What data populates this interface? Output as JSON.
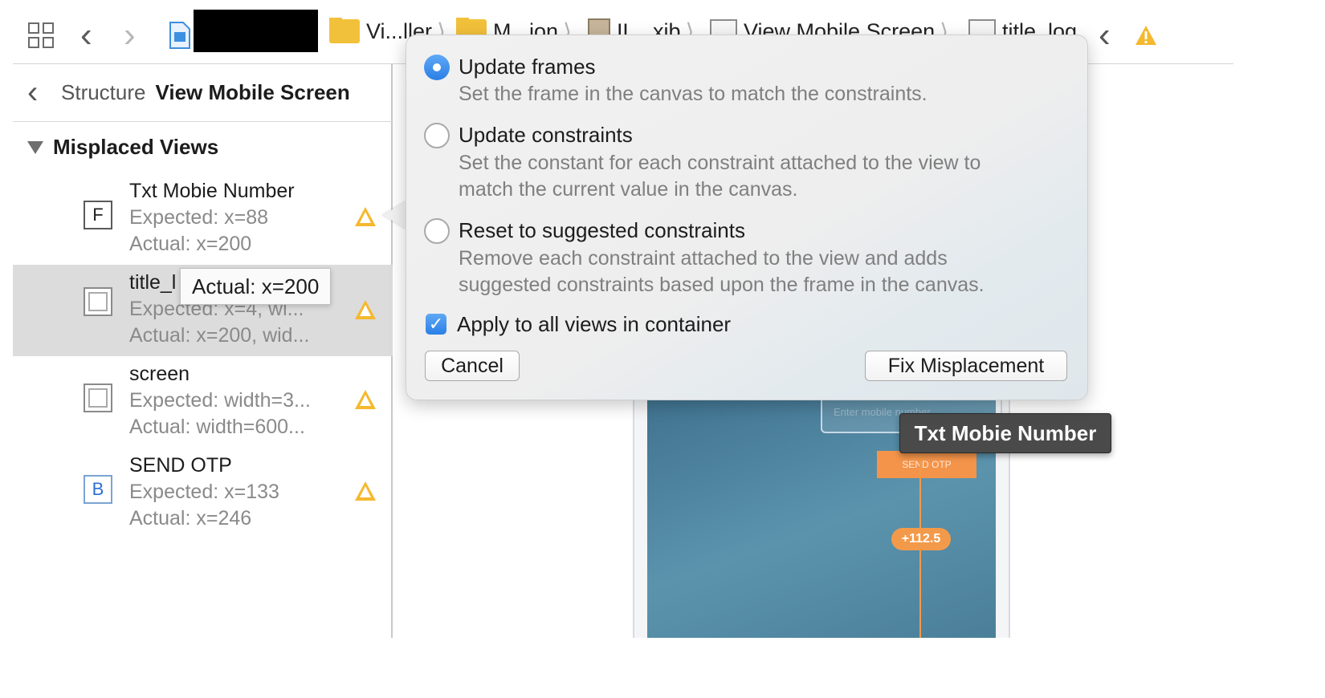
{
  "breadcrumbs": [
    {
      "label": "Vi...ller",
      "icon": "folder-icon"
    },
    {
      "label": "M...ion",
      "icon": "folder-icon"
    },
    {
      "label": "IL...xib",
      "icon": "xib-file-icon"
    },
    {
      "label": "View Mobile Screen",
      "icon": "view-icon"
    },
    {
      "label": "title_log",
      "icon": "image-view-icon"
    }
  ],
  "structure": {
    "back_label": "Structure",
    "title": "View Mobile Screen",
    "section_title": "Misplaced Views"
  },
  "misplaced_items": [
    {
      "name": "Txt Mobie Number",
      "badge": "F",
      "expected": "Expected: x=88",
      "actual": "Actual: x=200"
    },
    {
      "name": "title_l",
      "badge": "",
      "expected": "Expected: x=4, wi...",
      "actual": "Actual: x=200, wid..."
    },
    {
      "name": "screen",
      "badge": "",
      "expected": "Expected: width=3...",
      "actual": "Actual: width=600..."
    },
    {
      "name": "SEND OTP",
      "badge": "B",
      "expected": "Expected: x=133",
      "actual": "Actual: x=246"
    }
  ],
  "row_tooltip": "Actual: x=200",
  "popover": {
    "options": [
      {
        "title": "Update frames",
        "desc": [
          "Set the frame in the canvas to match the constraints."
        ],
        "selected": true
      },
      {
        "title": "Update constraints",
        "desc": [
          "Set the constant for each constraint attached to the view to",
          "match the current value in the canvas."
        ],
        "selected": false
      },
      {
        "title": "Reset to suggested constraints",
        "desc": [
          "Remove each constraint attached to the view and adds",
          "suggested constraints based upon the frame in the canvas."
        ],
        "selected": false
      }
    ],
    "apply_all_label": "Apply to all views in container",
    "apply_all_checked": true,
    "cancel_label": "Cancel",
    "fix_label": "Fix Misplacement"
  },
  "canvas": {
    "field_placeholder": "Enter mobile number",
    "send_button": "SEND OTP",
    "offset_label": "+112.5",
    "hover_tooltip": "Txt Mobie Number"
  },
  "colors": {
    "accent": "#2a7fe6",
    "warning": "#f5b82e",
    "guide": "#f39a4a"
  }
}
